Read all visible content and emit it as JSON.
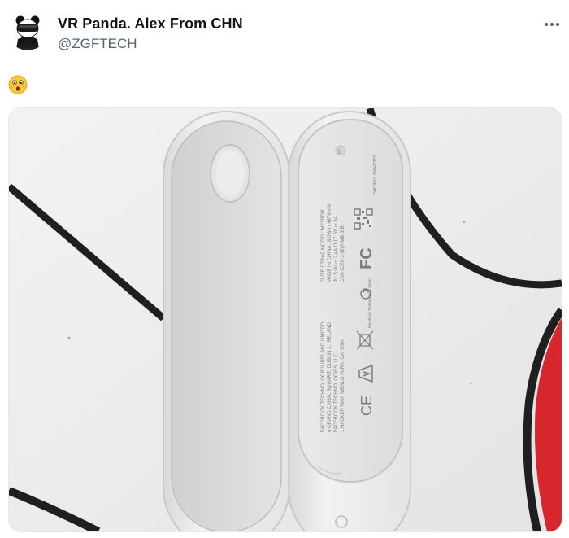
{
  "author": {
    "display_name": "VR Panda. Alex From CHN",
    "handle": "@ZGFTECH",
    "avatar_icon": "panda-vr-headset-avatar"
  },
  "menu": {
    "icon": "more-horizontal-icon"
  },
  "post": {
    "emoji_icon": "astonished-face-emoji",
    "photo": {
      "left_marker": "L",
      "label_lines": [
        "ELITE STRAP    MODEL: ME29EM",
        "MADE IN CHINA  18.0Wh / 4676mAh",
        "IN: 5.0V ⎓ 2.4A     OUT: 5V ⎓ 3A",
        "CAN ICES-3 (B)/NMB-3(B)",
        "FACEBOOK TECHNOLOGIES IRELAND LIMITED",
        "4 GRAND CANAL SQUARE, DUBLIN 2, IRELAND",
        "FACEBOOK TECHNOLOGIES, LLC",
        "1 HACKER WAY, MENLO PARK, CA, USA"
      ],
      "marks": {
        "fcc": "FC",
        "ce": "CE",
        "right_small_text": "150C9B/1 QRH2372",
        "recycle_text": "Facebook Technologies Japan"
      }
    }
  },
  "colors": {
    "name": "#0f1419",
    "handle": "#536471",
    "table": "#eceded",
    "lines": "#1f1f22",
    "red": "#d7262c",
    "plastic": "#ededeb"
  }
}
